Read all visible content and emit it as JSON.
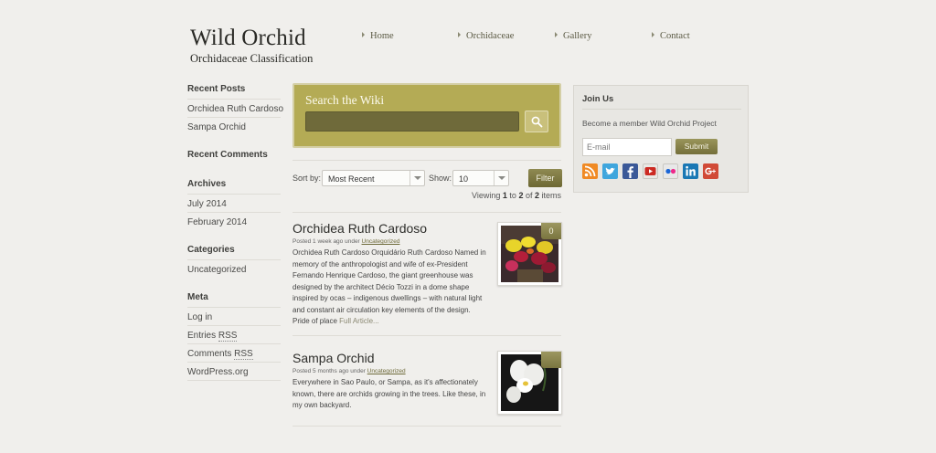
{
  "header": {
    "site_title": "Wild Orchid",
    "tagline": "Orchidaceae Classification"
  },
  "nav": [
    {
      "label": "Home"
    },
    {
      "label": "Orchidaceae"
    },
    {
      "label": "Gallery"
    },
    {
      "label": "Contact"
    }
  ],
  "sidebar": {
    "recent_posts_title": "Recent Posts",
    "recent_posts": [
      "Orchidea Ruth Cardoso",
      "Sampa Orchid"
    ],
    "recent_comments_title": "Recent Comments",
    "archives_title": "Archives",
    "archives": [
      "July 2014",
      "February 2014"
    ],
    "categories_title": "Categories",
    "categories": [
      "Uncategorized"
    ],
    "meta_title": "Meta",
    "meta": {
      "login": "Log in",
      "entries_prefix": "Entries ",
      "entries_rss": "RSS",
      "comments_prefix": "Comments ",
      "comments_rss": "RSS",
      "wordpress": "WordPress.org"
    }
  },
  "search": {
    "title": "Search the Wiki",
    "value": "",
    "placeholder": "",
    "icon": "search-icon"
  },
  "sort": {
    "sort_label": "Sort by:",
    "sort_value": "Most Recent",
    "show_label": "Show:",
    "show_value": "10",
    "filter_label": "Filter",
    "viewing_prefix": "Viewing ",
    "viewing_from": "1",
    "viewing_to_word": " to ",
    "viewing_to": "2",
    "viewing_of_word": " of ",
    "viewing_total": "2",
    "viewing_suffix": " items"
  },
  "posts": [
    {
      "title": "Orchidea Ruth Cardoso",
      "meta_prefix": "Posted 1 week ago under ",
      "category": "Uncategorized",
      "excerpt": "Orchidea Ruth Cardoso Orquidário Ruth Cardoso Named in memory of the anthropologist and wife of ex-President Fernando Henrique Cardoso, the giant greenhouse was designed by the architect Décio Tozzi in a dome shape inspired by ocas – indigenous dwellings – with natural light and constant air circulation key elements of the design. Pride of place ",
      "more": "Full Article...",
      "comments": "0"
    },
    {
      "title": "Sampa Orchid",
      "meta_prefix": "Posted 5 months ago under ",
      "category": "Uncategorized",
      "excerpt": "Everywhere in Sao Paulo, or Sampa, as it's affectionately known, there are orchids growing in the trees. Like these, in my own backyard.",
      "more": "",
      "comments": ""
    }
  ],
  "join": {
    "title": "Join Us",
    "text": "Become a member Wild Orchid Project",
    "email_placeholder": "E-mail",
    "email_value": "",
    "submit_label": "Submit",
    "social": [
      {
        "icon": "rss-icon",
        "color": "#f08a24"
      },
      {
        "icon": "twitter-icon",
        "color": "#3fa6dd"
      },
      {
        "icon": "facebook-icon",
        "color": "#3b5998"
      },
      {
        "icon": "youtube-icon",
        "color": "#cc2a22"
      },
      {
        "icon": "flickr-icon",
        "color": "#e8e8e8"
      },
      {
        "icon": "linkedin-icon",
        "color": "#1a78b4"
      },
      {
        "icon": "google-plus-icon",
        "color": "#d14a36"
      }
    ]
  },
  "colors": {
    "background": "#f0efec",
    "accent": "#b4ab55",
    "button": "#7d7845"
  }
}
